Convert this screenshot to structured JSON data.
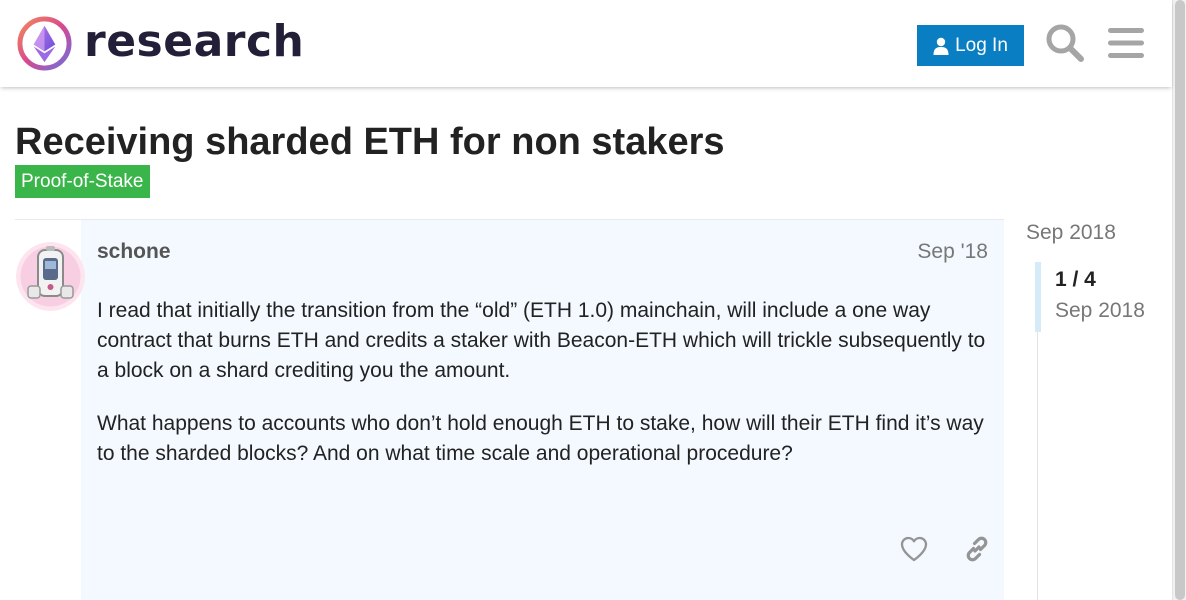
{
  "header": {
    "site_name": "research",
    "login_label": "Log In"
  },
  "topic": {
    "title": "Receiving sharded ETH for non stakers",
    "category": "Proof-of-Stake",
    "category_color": "#3ab54a"
  },
  "post": {
    "username": "schone",
    "date": "Sep '18",
    "paragraphs": [
      "I read that initially the transition from the “old” (ETH 1.0) mainchain, will include a one way contract that burns ETH and credits a staker with Beacon-ETH which will trickle subsequently to a block on a shard crediting you the amount.",
      "What happens to accounts who don’t hold enough ETH to stake, how will their ETH find it’s way to the sharded blocks? And on what time scale and operational procedure?"
    ],
    "actions": [
      "like-icon",
      "link-icon"
    ]
  },
  "timeline": {
    "start_date": "Sep 2018",
    "position": "1 / 4",
    "current_date": "Sep 2018"
  },
  "colors": {
    "accent": "#0a7ec2",
    "post_background": "#f3f9fe"
  }
}
